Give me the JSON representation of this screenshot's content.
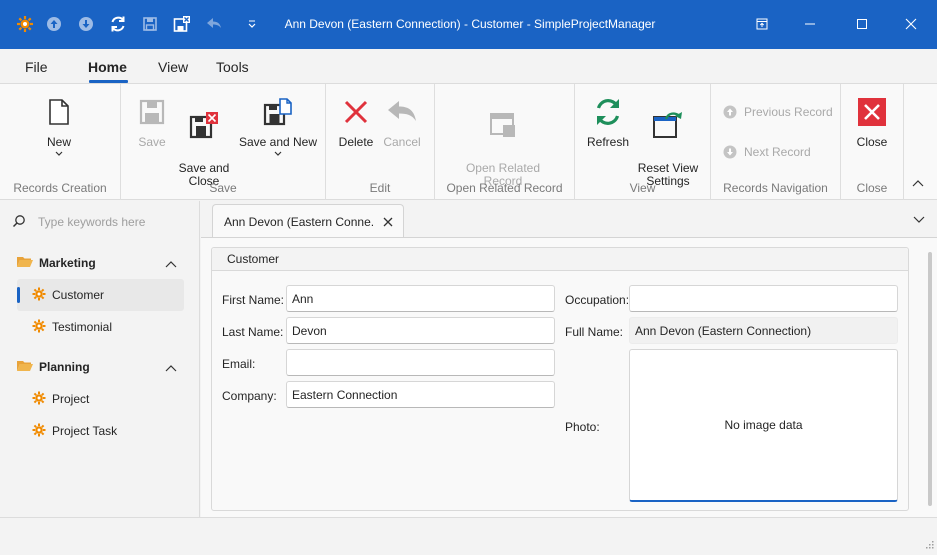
{
  "window": {
    "title": "Ann Devon (Eastern Connection) - Customer - SimpleProjectManager",
    "quick_access": [
      "app-logo-icon",
      "arrow-up-icon",
      "arrow-down-icon",
      "refresh-icon",
      "save-icon",
      "save-close-icon",
      "undo-icon",
      "customize-icon"
    ]
  },
  "menu": {
    "tabs": [
      "File",
      "Home",
      "View",
      "Tools"
    ],
    "active": "Home"
  },
  "ribbon": {
    "groups": {
      "records_creation": "Records Creation",
      "save": "Save",
      "edit": "Edit",
      "open_related": "Open Related Record",
      "view": "View",
      "navigation": "Records Navigation",
      "close": "Close"
    },
    "buttons": {
      "new": "New",
      "save": "Save",
      "save_and_close": "Save and\nClose",
      "save_and_new": "Save and New",
      "delete": "Delete",
      "cancel": "Cancel",
      "open_related": "Open Related\nRecord",
      "refresh": "Refresh",
      "reset_view": "Reset View\nSettings",
      "previous_record": "Previous Record",
      "next_record": "Next Record",
      "close": "Close"
    }
  },
  "sidebar": {
    "search_placeholder": "Type keywords here",
    "groups": [
      {
        "label": "Marketing",
        "items": [
          "Customer",
          "Testimonial"
        ]
      },
      {
        "label": "Planning",
        "items": [
          "Project",
          "Project Task"
        ]
      }
    ],
    "selected": "Customer"
  },
  "document": {
    "tab_label": "Ann Devon (Eastern Conne...",
    "group_title": "Customer",
    "fields": {
      "first_name": {
        "label": "First Name:",
        "value": "Ann"
      },
      "last_name": {
        "label": "Last Name:",
        "value": "Devon"
      },
      "email": {
        "label": "Email:",
        "value": ""
      },
      "company": {
        "label": "Company:",
        "value": "Eastern Connection"
      },
      "occupation": {
        "label": "Occupation:",
        "value": ""
      },
      "full_name": {
        "label": "Full Name:",
        "value": "Ann Devon (Eastern Connection)"
      },
      "photo": {
        "label": "Photo:",
        "value": "No image data"
      }
    }
  },
  "colors": {
    "accent": "#1a63c4",
    "delete_red": "#e0323c",
    "refresh_green": "#1e8f5b",
    "folder_orange": "#e8a33a",
    "gear_orange": "#f08a00"
  }
}
